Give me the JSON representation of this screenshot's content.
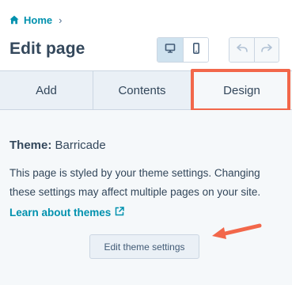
{
  "breadcrumb": {
    "home_label": "Home",
    "separator": "›"
  },
  "header": {
    "title": "Edit page"
  },
  "toolbar": {
    "desktop_icon": "desktop-icon",
    "mobile_icon": "mobile-icon",
    "undo_icon": "undo-icon",
    "redo_icon": "redo-icon"
  },
  "tabs": [
    {
      "label": "Add"
    },
    {
      "label": "Contents"
    },
    {
      "label": "Design",
      "active": true
    }
  ],
  "design": {
    "theme_label": "Theme:",
    "theme_name": "Barricade",
    "description": "This page is styled by your theme settings. Changing these settings may affect multiple pages on your site.",
    "learn_link": "Learn about themes",
    "edit_button": "Edit theme settings"
  },
  "colors": {
    "link": "#0091ae",
    "text": "#33475b",
    "highlight": "#f2674a",
    "panel_bg": "#f5f8fa",
    "tab_bg": "#eaf0f6"
  }
}
